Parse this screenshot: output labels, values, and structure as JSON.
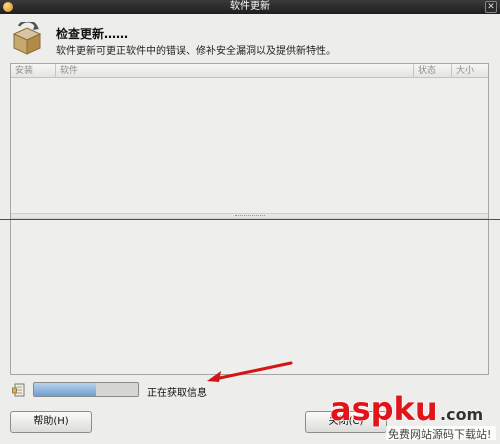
{
  "window": {
    "title": "软件更新"
  },
  "header": {
    "heading": "检查更新……",
    "subtext": "软件更新可更正软件中的错误、修补安全漏洞以及提供新特性。"
  },
  "table": {
    "columns": [
      "安装",
      "软件",
      "状态",
      "大小"
    ]
  },
  "status": {
    "progress_fraction": 0.6,
    "text": "正在获取信息"
  },
  "buttons": {
    "help": "帮助(H)",
    "close": "关闭(C)"
  },
  "watermark": {
    "brand": "aspku",
    "brand_suffix": ".com",
    "tagline": "免费网站源码下载站!"
  },
  "colors": {
    "accent_red": "#cc1b1b",
    "progress": "#6f9fd0",
    "watermark_red": "#e1141c"
  }
}
